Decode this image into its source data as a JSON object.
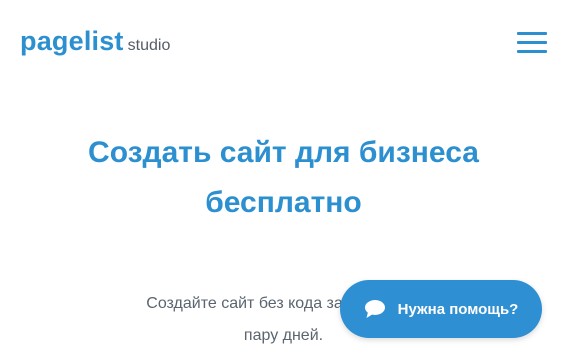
{
  "header": {
    "logo_main": "pagelist",
    "logo_sub": "studio",
    "menu_icon": "hamburger-menu-icon"
  },
  "hero": {
    "title_line1": "Создать сайт для бизнеса",
    "title_line2": "бесплатно",
    "subtitle_line1": "Создайте сайт без кода за 5 минут, и",
    "subtitle_line2": "пару дней."
  },
  "chat_widget": {
    "label": "Нужна помощь?",
    "icon": "chat-bubble-icon"
  },
  "colors": {
    "brand": "#2b8fd0",
    "widget_bg": "#2f8fd3",
    "text_muted": "#5a6570"
  }
}
